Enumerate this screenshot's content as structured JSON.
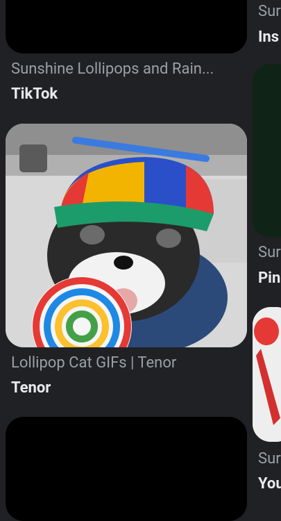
{
  "left_column": {
    "top": {
      "source": "TikTok",
      "caption": "Sunshine Lollipops and Rain..."
    },
    "middle": {
      "source": "Tenor",
      "caption": "Lollipop Cat GIFs | Tenor"
    }
  },
  "right_column": {
    "items": [
      {
        "caption": "Sur",
        "source": "Ins"
      },
      {
        "caption": "Sur",
        "source": "Pin"
      },
      {
        "caption": "Sur",
        "source": "You"
      }
    ]
  }
}
